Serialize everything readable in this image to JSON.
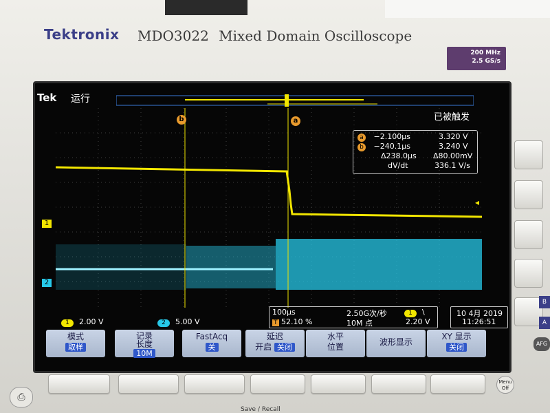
{
  "device": {
    "brand": "Tektronix",
    "model": "MDO3022",
    "description": "Mixed Domain Oscilloscope",
    "spec_line1": "200 MHz",
    "spec_line2": "2.5 GS/s"
  },
  "screen": {
    "tek_logo": "Tek",
    "run_state": "运行",
    "trigger_state": "已被触发",
    "cursor_a_label": "a",
    "cursor_b_label": "b",
    "cursor_readout": {
      "a_time": "−2.100µs",
      "a_value": "3.320 V",
      "b_time": "−240.1µs",
      "b_value": "3.240 V",
      "delta_time": "Δ238.0µs",
      "delta_value": "Δ80.00mV",
      "dvdt_label": "dV/dt",
      "dvdt_value": "336.1 V/s"
    },
    "channel_markers": [
      "1",
      "2"
    ],
    "bottom": {
      "ch1_num": "1",
      "ch1_scale": "2.00 V",
      "ch2_num": "2",
      "ch2_scale": "5.00 V",
      "timebase": "100µs",
      "trigger_pos_icon": "T",
      "trigger_pos": "52.10 %",
      "sample_rate": "2.50G次/秒",
      "record_length": "10M 点",
      "trig_source": "1",
      "trig_slope": "\\",
      "trig_level": "2.20 V",
      "date": "10 4月 2019",
      "time": "11:26:51"
    },
    "menu": [
      {
        "title": "模式",
        "value": "取样"
      },
      {
        "title": "记录\n长度",
        "value": "10M"
      },
      {
        "title": "FastAcq",
        "value": "关"
      },
      {
        "title": "延迟",
        "opt1": "开启",
        "value": "关闭"
      },
      {
        "title": "水平\n位置",
        "value": ""
      },
      {
        "title": "波形显示",
        "value": ""
      },
      {
        "title": "XY 显示",
        "value": "关闭"
      }
    ]
  },
  "panel": {
    "menu_off_label": "Menu\nOff",
    "save_recall_label": "Save / Recall",
    "side_letters": [
      "B",
      "A",
      "AFG"
    ]
  },
  "colors": {
    "ch1": "#f2e600",
    "ch2": "#27c8e8",
    "cursor": "#e89a2d",
    "brand": "#3b3f88"
  },
  "icons": [
    "printer-icon",
    "trigger-icon"
  ]
}
